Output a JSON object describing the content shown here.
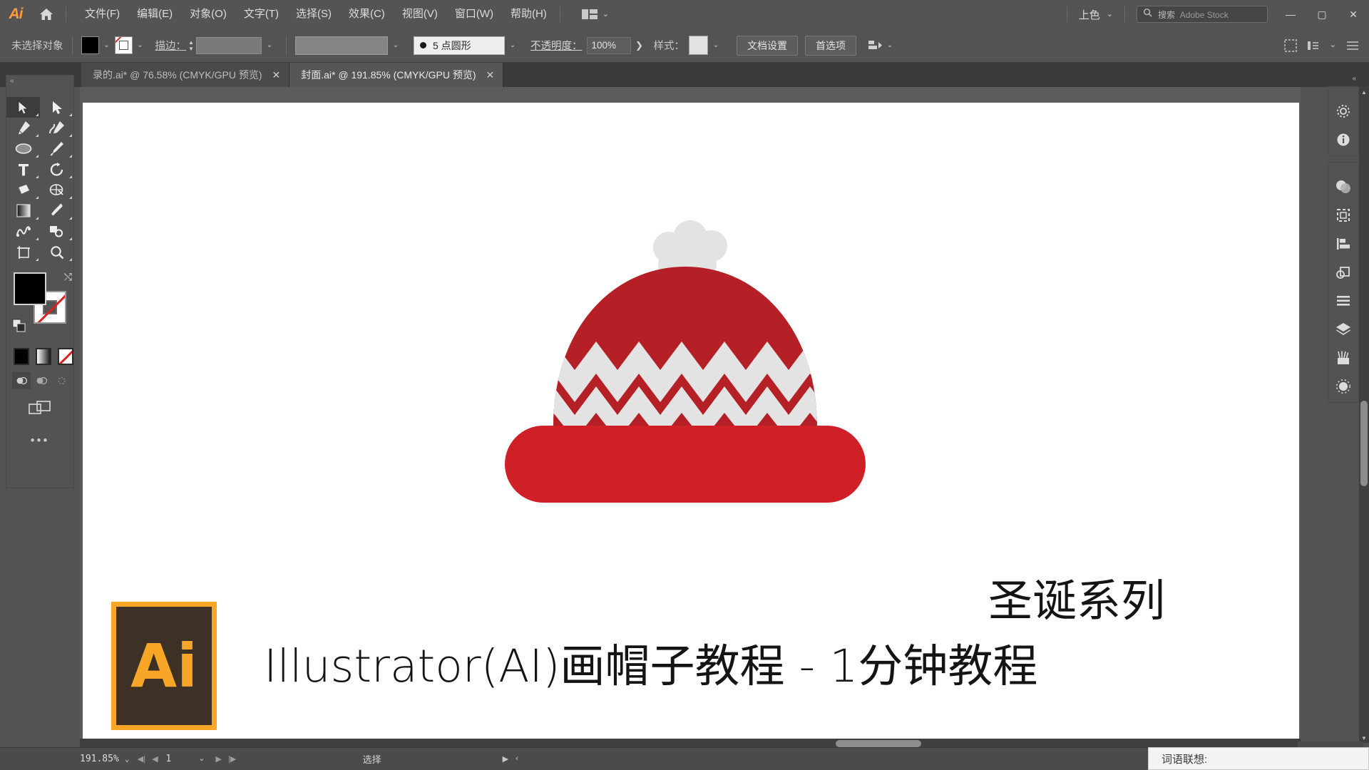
{
  "app": {
    "name": "Adobe Illustrator",
    "logo_text": "Ai",
    "accent": "#ff9a3c",
    "chrome_bg": "#535353"
  },
  "menubar": {
    "home_icon": "home-icon",
    "items": [
      {
        "label": "文件(F)",
        "key": "F"
      },
      {
        "label": "编辑(E)",
        "key": "E"
      },
      {
        "label": "对象(O)",
        "key": "O"
      },
      {
        "label": "文字(T)",
        "key": "T"
      },
      {
        "label": "选择(S)",
        "key": "S"
      },
      {
        "label": "效果(C)",
        "key": "C"
      },
      {
        "label": "视图(V)",
        "key": "V"
      },
      {
        "label": "窗口(W)",
        "key": "W"
      },
      {
        "label": "帮助(H)",
        "key": "H"
      }
    ],
    "workspace_switcher_icon": "workspace-layout-icon",
    "color_mode": "上色",
    "search": {
      "icon": "search-icon",
      "placeholder_cn": "搜索",
      "placeholder_brand": "Adobe Stock"
    },
    "window_controls": {
      "minimize": "—",
      "maximize": "▢",
      "close": "✕"
    }
  },
  "controlbar": {
    "selection_status": "未选择对象",
    "fill_color": "#000000",
    "stroke_color": "none",
    "stroke_label": "描边：",
    "stroke_weight": "",
    "profile_value": "",
    "brush_value": "5 点圆形",
    "opacity_label": "不透明度：",
    "opacity_value": "100%",
    "style_label": "样式：",
    "style_swatch": "#e2e2e2",
    "buttons": [
      {
        "label": "文档设置"
      },
      {
        "label": "首选项"
      }
    ],
    "align_icon": "align-icon",
    "right_icons": [
      "transform-icon",
      "arrange-icon",
      "panel-menu-icon"
    ]
  },
  "tabs": [
    {
      "label": "录的.ai* @ 76.58% (CMYK/GPU 预览)",
      "active": false,
      "close": "✕"
    },
    {
      "label": "封面.ai* @ 191.85% (CMYK/GPU 预览)",
      "active": true,
      "close": "✕"
    }
  ],
  "toolbar": {
    "grip": "«",
    "tools": [
      {
        "name": "selection-tool",
        "label": "选择工具",
        "selected": true
      },
      {
        "name": "direct-selection-tool",
        "label": "直接选择工具",
        "selected": false
      },
      {
        "name": "pen-tool",
        "label": "钢笔工具",
        "selected": false
      },
      {
        "name": "curvature-tool",
        "label": "曲率工具",
        "selected": false
      },
      {
        "name": "ellipse-tool",
        "label": "椭圆工具",
        "selected": false
      },
      {
        "name": "paintbrush-tool",
        "label": "画笔工具",
        "selected": false
      },
      {
        "name": "type-tool",
        "label": "文字工具",
        "selected": false
      },
      {
        "name": "rotate-tool",
        "label": "旋转工具",
        "selected": false
      },
      {
        "name": "shape-builder-tool",
        "label": "形状生成器工具",
        "selected": false
      },
      {
        "name": "gradient-mesh-tool",
        "label": "网格工具",
        "selected": false
      },
      {
        "name": "gradient-tool",
        "label": "渐变工具",
        "selected": false
      },
      {
        "name": "eyedropper-tool",
        "label": "吸管工具",
        "selected": false
      },
      {
        "name": "blend-tool",
        "label": "混合工具",
        "selected": false
      },
      {
        "name": "symbol-sprayer-tool",
        "label": "符号喷枪工具",
        "selected": false
      },
      {
        "name": "artboard-tool",
        "label": "画板工具",
        "selected": false
      },
      {
        "name": "zoom-tool",
        "label": "缩放工具",
        "selected": false
      }
    ],
    "fill_color": "#000000",
    "stroke_color": "#ffffff",
    "stroke_is_none": true,
    "color_modes": [
      {
        "name": "color-mode",
        "selected": true
      },
      {
        "name": "gradient-mode",
        "selected": false
      },
      {
        "name": "none-mode",
        "selected": false
      }
    ],
    "draw_modes": [
      {
        "name": "draw-normal",
        "selected": true
      },
      {
        "name": "draw-behind",
        "selected": false
      },
      {
        "name": "draw-inside",
        "selected": false
      }
    ],
    "screen_mode_icon": "screen-mode-icon",
    "more_tools": "•••"
  },
  "dock": {
    "grip": "«",
    "groups": [
      {
        "icons": [
          {
            "name": "properties-icon",
            "label": "属性"
          },
          {
            "name": "info-icon",
            "label": "信息"
          }
        ]
      },
      {
        "icons": [
          {
            "name": "color-icon",
            "label": "颜色"
          },
          {
            "name": "transform-icon",
            "label": "变换"
          },
          {
            "name": "align-icon",
            "label": "对齐"
          },
          {
            "name": "pathfinder-icon",
            "label": "路径查找器"
          },
          {
            "name": "stroke-icon",
            "label": "描边"
          },
          {
            "name": "layers-icon",
            "label": "图层"
          },
          {
            "name": "brushes-icon",
            "label": "画笔"
          },
          {
            "name": "appearance-icon",
            "label": "外观"
          }
        ]
      }
    ]
  },
  "canvas": {
    "artboard_bg": "#ffffff",
    "artwork": {
      "title": "圣诞帽插图",
      "hat": {
        "pompom_color": "#e3e3e3",
        "crown_color": "#b52026",
        "zigzag_color": "#e3e3e3",
        "brim_color": "#cf2027"
      },
      "text_series": "圣诞系列",
      "text_main": "Illustrator(AI)画帽子教程 - 1分钟教程",
      "badge": {
        "letters": "Ai",
        "frame_color": "#f7a628",
        "inner_color": "#3d3025"
      }
    }
  },
  "statusbar": {
    "zoom_level": "191.85%",
    "page_number": "1",
    "current_tool": "选择",
    "nav_first": "◀|",
    "nav_prev": "◀",
    "nav_next": "▶",
    "nav_last": "|▶",
    "arrow_right": "▶",
    "arrow_left": "‹"
  },
  "ime": {
    "label": "词语联想:"
  }
}
